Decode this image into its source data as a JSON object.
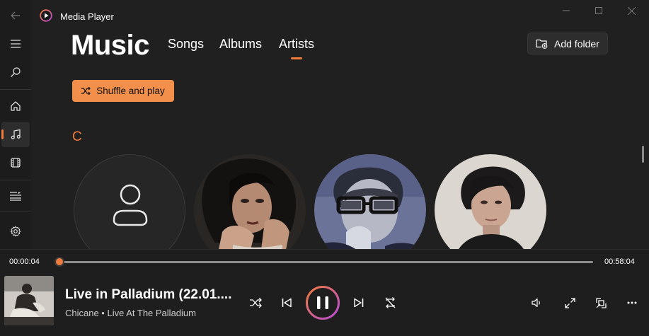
{
  "window": {
    "title": "Media Player"
  },
  "colors": {
    "accent": "#f07b3a",
    "background": "#202020"
  },
  "nav": {
    "items": [
      {
        "name": "back",
        "icon": "back-arrow-icon"
      },
      {
        "name": "menu",
        "icon": "hamburger-icon"
      },
      {
        "name": "search",
        "icon": "search-icon"
      },
      {
        "name": "home",
        "icon": "home-icon"
      },
      {
        "name": "music",
        "icon": "music-note-icon",
        "active": true
      },
      {
        "name": "video",
        "icon": "film-icon"
      },
      {
        "name": "playlists",
        "icon": "playlist-icon"
      },
      {
        "name": "settings",
        "icon": "gear-icon"
      }
    ]
  },
  "header": {
    "title": "Music",
    "tabs": [
      {
        "label": "Songs",
        "selected": false
      },
      {
        "label": "Albums",
        "selected": false
      },
      {
        "label": "Artists",
        "selected": true
      }
    ],
    "add_folder_label": "Add folder"
  },
  "content": {
    "shuffle_label": "Shuffle and play",
    "group_letter": "C"
  },
  "player": {
    "elapsed": "00:00:04",
    "total": "00:58:04",
    "progress": 0.001,
    "song_title": "Live in Palladium (22.01....",
    "song_subtitle": "Chicane • Live At The Palladium",
    "state": "playing"
  }
}
